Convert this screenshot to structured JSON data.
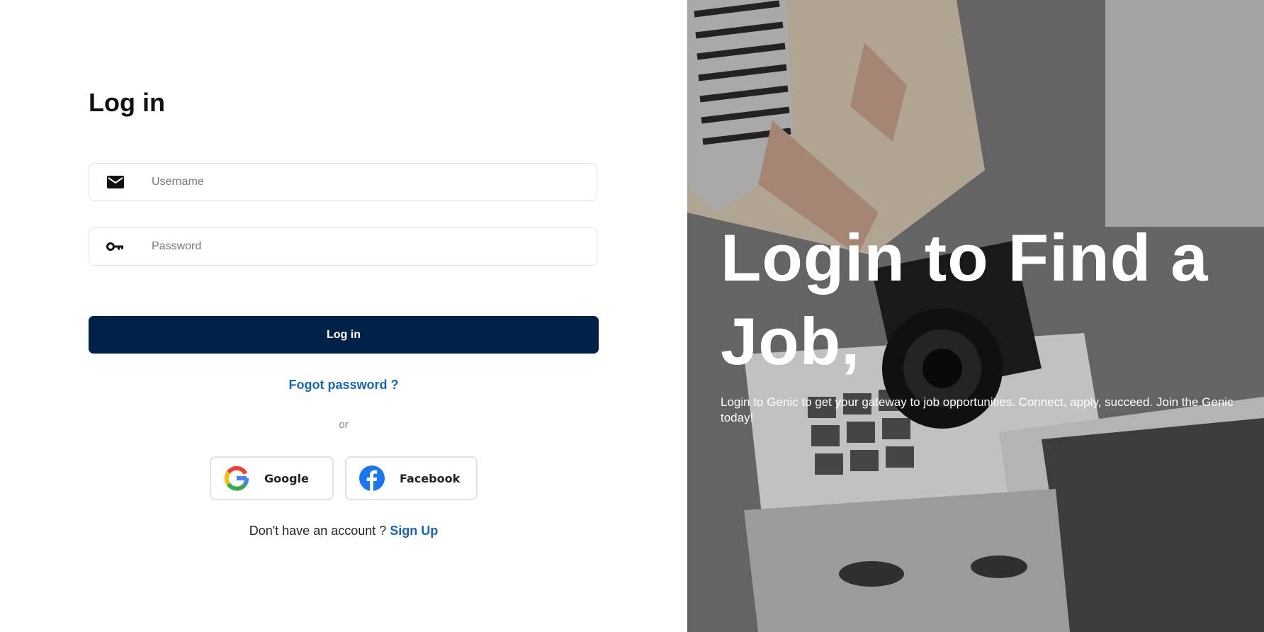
{
  "login": {
    "title": "Log in",
    "username_placeholder": "Username",
    "password_placeholder": "Password",
    "submit_label": "Log in",
    "forgot_label": "Fogot password ?",
    "or_label": "or",
    "google_label": "Google",
    "facebook_label": "Facebook",
    "no_account_text": "Don't have an account ?",
    "signup_label": "Sign Up"
  },
  "hero": {
    "heading": "Login to Find a Job,",
    "subtext": "Login to Genic to get your gateway to job opportunities. Connect, apply, succeed. Join the Genic today!"
  },
  "colors": {
    "primary_button": "#002248",
    "link": "#1565c0",
    "border": "#e2e2e2"
  },
  "icons": {
    "username": "mail-icon",
    "password": "key-icon",
    "google": "google-logo-icon",
    "facebook": "facebook-logo-icon"
  }
}
